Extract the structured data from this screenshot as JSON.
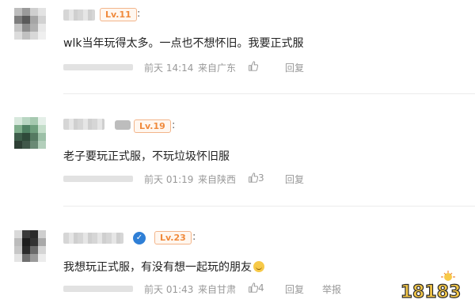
{
  "comments": [
    {
      "level": "Lv.11",
      "text": "wlk当年玩得太多。一点也不想怀旧。我要正式服",
      "time": "前天 14:14",
      "location": "来自广东",
      "likes": "",
      "reply": "回复",
      "report": ""
    },
    {
      "level": "Lv.19",
      "text": "老子要玩正式服，不玩垃圾怀旧服",
      "time": "前天 01:19",
      "location": "来自陕西",
      "likes": "3",
      "reply": "回复",
      "report": ""
    },
    {
      "level": "Lv.23",
      "text": "我想玩正式服，有没有想一起玩的朋友",
      "time": "前天 01:43",
      "location": "来自甘肃",
      "likes": "4",
      "reply": "回复",
      "report": "举报"
    }
  ],
  "colon": ":",
  "watermark": {
    "text": "18183"
  },
  "icons": {
    "like": "thumbs-up-icon",
    "verified": "verified-badge-icon",
    "emoji": "smile-emoji-icon"
  },
  "colors": {
    "level_border": "#f3b58a",
    "level_text": "#f08a3c",
    "meta": "#999999"
  }
}
